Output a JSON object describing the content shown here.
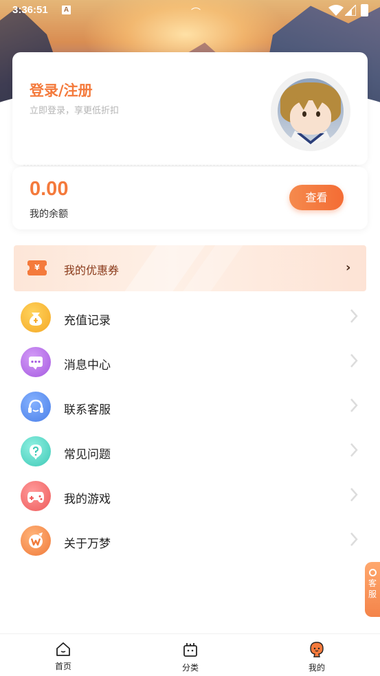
{
  "status_bar": {
    "time": "3:36:51",
    "notification_icon": "A"
  },
  "login": {
    "title": "登录/注册",
    "subtitle": "立即登录，享更低折扣"
  },
  "balance": {
    "amount": "0.00",
    "label": "我的余额",
    "button": "查看"
  },
  "coupon": {
    "label": "我的优惠券",
    "icon": "¥"
  },
  "menu": [
    {
      "label": "充值记录",
      "icon": "money-bag-icon",
      "color": "#f7b733"
    },
    {
      "label": "消息中心",
      "icon": "message-icon",
      "color": "#b66ee8"
    },
    {
      "label": "联系客服",
      "icon": "headset-icon",
      "color": "#5b8ef0"
    },
    {
      "label": "常见问题",
      "icon": "question-icon",
      "color": "#4fd1c1"
    },
    {
      "label": "我的游戏",
      "icon": "gamepad-icon",
      "color": "#f46b6b"
    },
    {
      "label": "关于万梦",
      "icon": "brand-w-icon",
      "color": "#f7904a"
    }
  ],
  "float_service": {
    "line1": "客",
    "line2": "服"
  },
  "tabs": [
    {
      "label": "首页",
      "icon": "home-icon"
    },
    {
      "label": "分类",
      "icon": "category-icon"
    },
    {
      "label": "我的",
      "icon": "profile-icon"
    }
  ],
  "colors": {
    "accent": "#f47a3c",
    "coupon_text": "#8a3a1a"
  }
}
